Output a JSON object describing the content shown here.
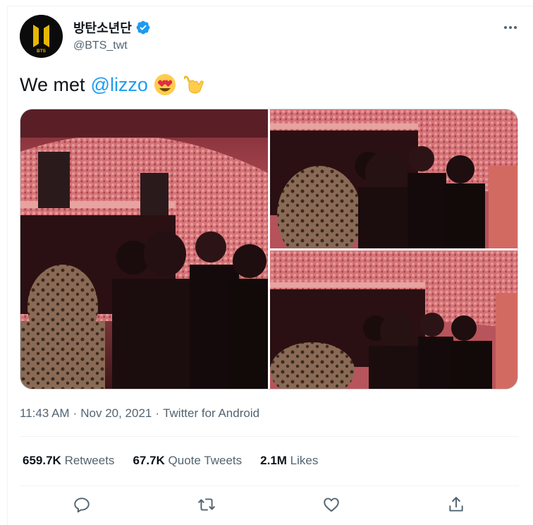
{
  "author": {
    "display_name": "방탄소년단",
    "handle": "@BTS_twt",
    "avatar_text": "BTS",
    "avatar_icon": "bts-logo-avatar",
    "verified_icon": "verified-badge-icon"
  },
  "tweet": {
    "text_prefix": "We met",
    "mention": "@lizzo",
    "emojis": [
      "heart-eyes-emoji",
      "call-me-hand-emoji"
    ]
  },
  "media": {
    "photos": [
      {
        "name": "concert-photo-1"
      },
      {
        "name": "concert-photo-2"
      },
      {
        "name": "concert-photo-3"
      }
    ]
  },
  "meta": {
    "time": "11:43 AM",
    "separator1": "·",
    "date": "Nov 20, 2021",
    "separator2": "·",
    "source": "Twitter for Android"
  },
  "stats": {
    "retweets_count": "659.7K",
    "retweets_label": "Retweets",
    "quote_count": "67.7K",
    "quote_label": "Quote Tweets",
    "likes_count": "2.1M",
    "likes_label": "Likes"
  },
  "actions": [
    "reply-icon",
    "retweet-icon",
    "like-icon",
    "share-icon"
  ],
  "colors": {
    "accent": "#1d9bf0",
    "text_primary": "#0f1419",
    "text_secondary": "#536471",
    "divider": "#eff3f4",
    "avatar_gold": "#e6b800"
  }
}
